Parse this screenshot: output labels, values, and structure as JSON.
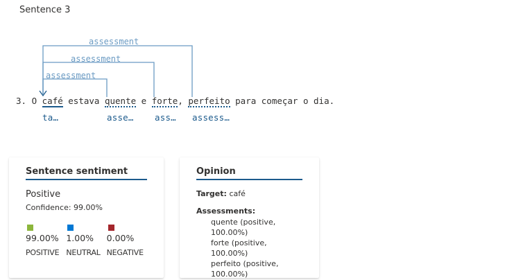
{
  "sentence_title": "Sentence 3",
  "arc_label": "assessment",
  "sentence": {
    "prefix": "3. O ",
    "target": "café",
    "t1": " estava ",
    "a1": "quente",
    "t2": " e ",
    "a2": "forte",
    "t3": ", ",
    "a3": "perfeito",
    "t4": " para começar o dia."
  },
  "tags": {
    "target": "ta…",
    "a1": "asse…",
    "a2": "ass…",
    "a3": "assess…"
  },
  "sentiment_card": {
    "title": "Sentence sentiment",
    "label": "Positive",
    "confidence": "Confidence: 99.00%",
    "scores": [
      {
        "value": "99.00%",
        "label": "POSITIVE",
        "color": "#8cb63c"
      },
      {
        "value": "1.00%",
        "label": "NEUTRAL",
        "color": "#0078d4"
      },
      {
        "value": "0.00%",
        "label": "NEGATIVE",
        "color": "#a4262c"
      }
    ]
  },
  "opinion_card": {
    "title": "Opinion",
    "target_key": "Target:",
    "target_value": "café",
    "assessments_key": "Assessments:",
    "assessments": [
      "quente (positive, 100.00%)",
      "forte (positive, 100.00%)",
      "perfeito (positive, 100.00%)"
    ]
  }
}
